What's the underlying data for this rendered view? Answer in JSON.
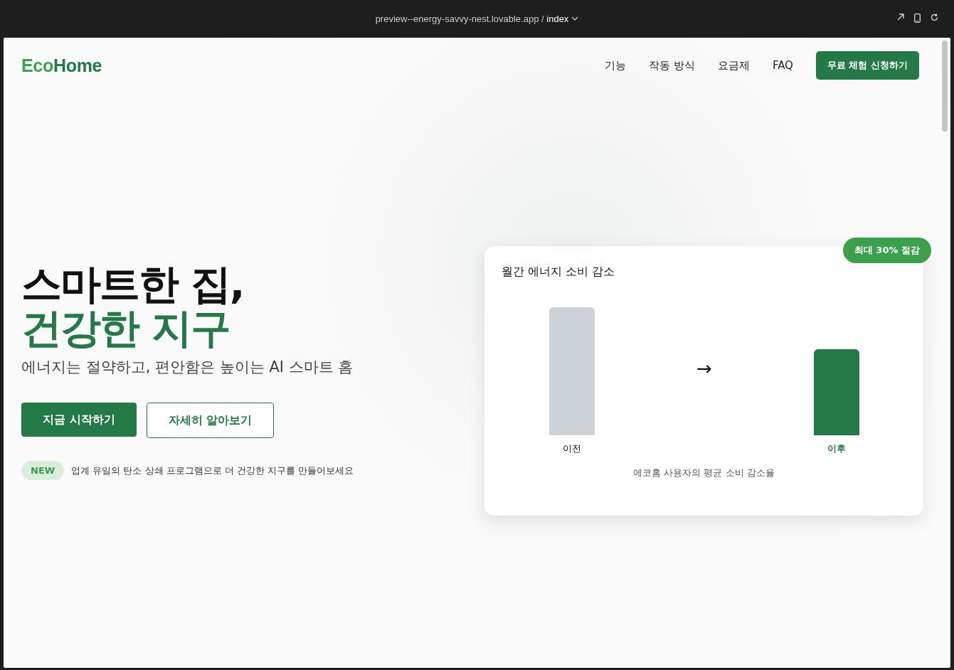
{
  "browser": {
    "url": "preview--energy-savvy-nest.lovable.app",
    "separator": "/",
    "path": "index"
  },
  "nav": {
    "logo": {
      "prefix": "Eco",
      "suffix": "Home"
    },
    "links": [
      "기능",
      "작동 방식",
      "요금제",
      "FAQ"
    ],
    "cta": "무료 체험 신청하기"
  },
  "hero": {
    "title_line_1": "스마트한 집,",
    "title_line_2": "건강한 지구",
    "subtitle": "에너지는 절약하고, 편안함은 높이는 AI 스마트 홈",
    "primary_button": "지금 시작하기",
    "secondary_button": "자세히 알아보기",
    "badge": "NEW",
    "note": "업계 유일의 탄소 상쇄 프로그램으로 더 건강한 지구를 만들어보세요"
  },
  "card": {
    "title": "월간 에너지 소비 감소",
    "ribbon": "최대 30% 절감",
    "arrow": "→",
    "bars": [
      {
        "label": "이전",
        "kind": "before"
      },
      {
        "label": "이후",
        "kind": "after"
      }
    ],
    "caption": "에코홈 사용자의 평균 소비 감소율"
  }
}
